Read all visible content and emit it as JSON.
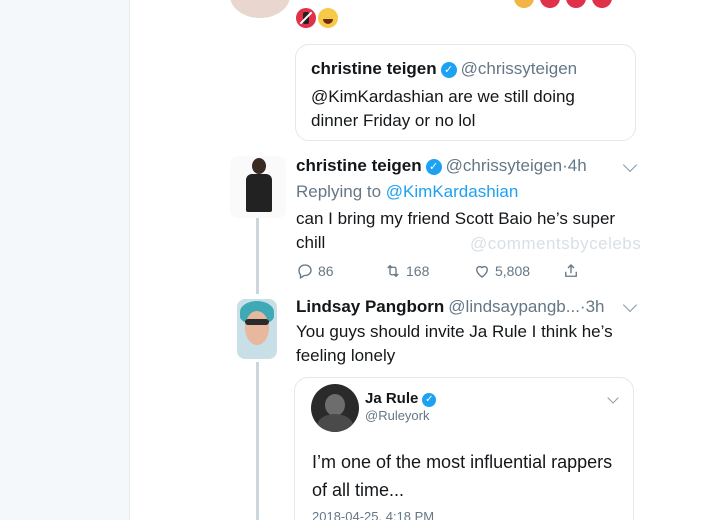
{
  "quoted_tweet": {
    "name": "christine teigen",
    "handle": "@chrissyteigen",
    "text": "@KimKardashian are we still doing dinner Friday or no lol"
  },
  "reply_tweet": {
    "name": "christine teigen",
    "handle": "@chrissyteigen",
    "separator": "·",
    "time": "4h",
    "replying_prefix": "Replying to",
    "replying_mention": "@KimKardashian",
    "text": "can I bring my friend Scott Baio he’s super chill",
    "watermark": "@commentsbycelebs",
    "actions": {
      "replies": "86",
      "retweets": "168",
      "likes": "5,808"
    }
  },
  "second_tweet": {
    "name": "Lindsay Pangborn",
    "handle": "@lindsaypangb...",
    "separator": "·",
    "time": "3h",
    "text": "You guys should invite Ja Rule I think he’s feeling lonely"
  },
  "embedded_tweet": {
    "name": "Ja Rule",
    "handle": "@Ruleyork",
    "text": "I’m one of the most influential rappers of all time...",
    "timestamp": "2018-04-25, 4:18 PM"
  },
  "icons": {
    "reply": "reply-icon",
    "retweet": "retweet-icon",
    "like": "heart-icon",
    "share": "share-icon",
    "verified": "verified-badge-icon",
    "menu": "chevron-down-icon"
  },
  "colors": {
    "accent": "#1da1f2",
    "text_primary": "#14171a",
    "text_secondary": "#657786",
    "border": "#e1e8ed"
  }
}
